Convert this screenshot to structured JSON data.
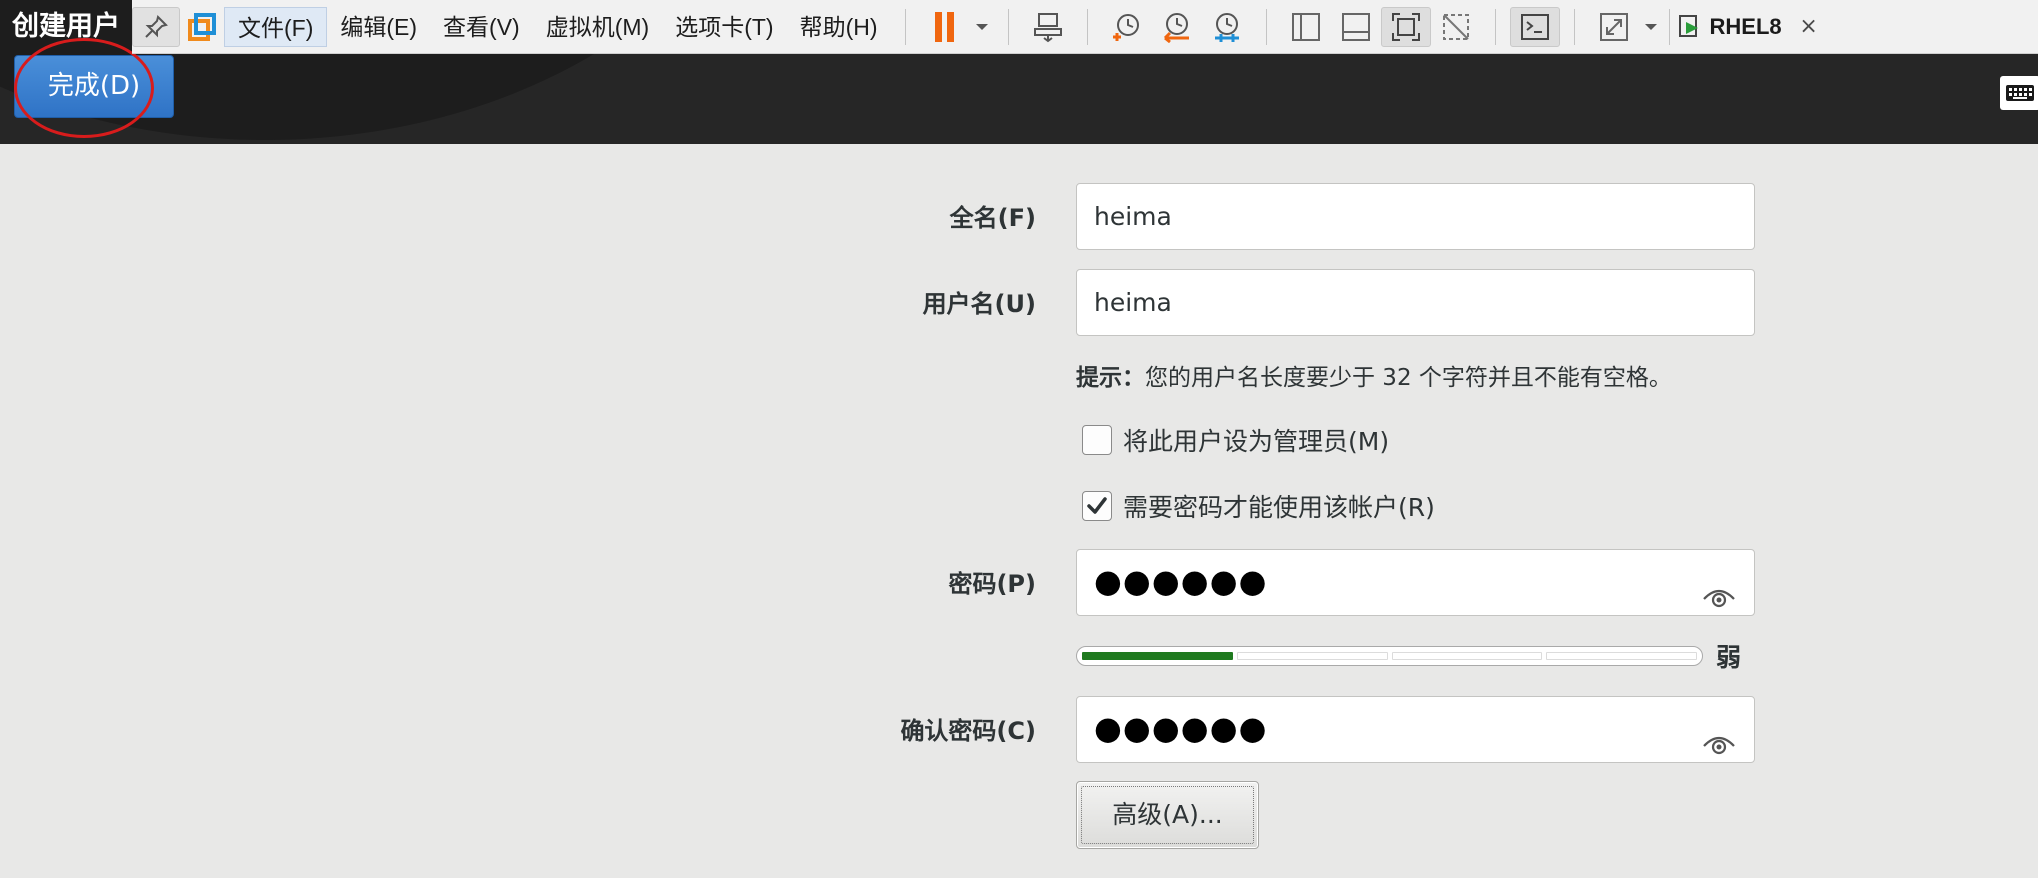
{
  "header": {
    "title": "创建用户",
    "done_button": "完成(D)"
  },
  "toolbar": {
    "menus": [
      "文件(F)",
      "编辑(E)",
      "查看(V)",
      "虚拟机(M)",
      "选项卡(T)",
      "帮助(H)"
    ],
    "vm_name": "RHEL8",
    "close_glyph": "×",
    "icons": [
      "pin-icon",
      "vmware-logo-icon",
      "pause-icon",
      "dropdown-icon",
      "send-ctrl-alt-del-icon",
      "snapshot-take-icon",
      "snapshot-revert-icon",
      "snapshot-manager-icon",
      "view-sidebar-icon",
      "view-thumbnail-icon",
      "fit-guest-icon",
      "unity-icon",
      "console-icon",
      "fullscreen-icon",
      "dropdown-icon",
      "vm-tab-icon",
      "close-icon"
    ]
  },
  "form": {
    "fullname_label": "全名(F)",
    "fullname_value": "heima",
    "username_label": "用户名(U)",
    "username_value": "heima",
    "hint_prefix": "提示：",
    "hint_text": "您的用户名长度要少于 32 个字符并且不能有空格。",
    "admin_checkbox_label": "将此用户设为管理员(M)",
    "admin_checked": false,
    "require_password_label": "需要密码才能使用该帐户(R)",
    "require_password_checked": true,
    "password_label": "密码(P)",
    "password_mask": "●●●●●●",
    "strength_level": 0.25,
    "strength_text": "弱",
    "confirm_label": "确认密码(C)",
    "confirm_mask": "●●●●●●",
    "advanced_button": "高级(A)..."
  },
  "colors": {
    "accent_blue": "#3a80d0",
    "annotation_red": "#d81c1c",
    "strength_green": "#1f7a1f",
    "header_dark": "#262626"
  }
}
